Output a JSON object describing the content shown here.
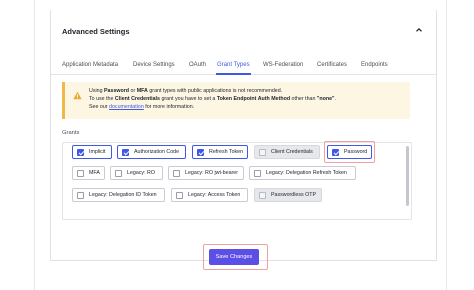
{
  "section": {
    "title": "Advanced Settings"
  },
  "tabs": [
    {
      "label": "Application Metadata",
      "active": false
    },
    {
      "label": "Device Settings",
      "active": false
    },
    {
      "label": "OAuth",
      "active": false
    },
    {
      "label": "Grant Types",
      "active": true
    },
    {
      "label": "WS-Federation",
      "active": false
    },
    {
      "label": "Certificates",
      "active": false
    },
    {
      "label": "Endpoints",
      "active": false
    }
  ],
  "warning": {
    "line1_a": "Using ",
    "line1_b": "Password",
    "line1_c": " or ",
    "line1_d": "MFA",
    "line1_e": " grant types with public applications is not recommended.",
    "line2_a": "To use the ",
    "line2_b": "Client Credentials",
    "line2_c": " grant you have to set a ",
    "line2_d": "Token Endpoint Auth Method",
    "line2_e": " other than ",
    "line2_f": "\"none\"",
    "line2_g": ".",
    "line3_a": "See our ",
    "line3_link": "documentation",
    "line3_b": " for more information."
  },
  "grants": {
    "label": "Grants",
    "items": [
      {
        "label": "Implicit",
        "checked": true,
        "disabled": false
      },
      {
        "label": "Authorization Code",
        "checked": true,
        "disabled": false
      },
      {
        "label": "Refresh Token",
        "checked": true,
        "disabled": false
      },
      {
        "label": "Client Credentials",
        "checked": false,
        "disabled": true
      },
      {
        "label": "Password",
        "checked": true,
        "disabled": false
      },
      {
        "label": "MFA",
        "checked": false,
        "disabled": false
      },
      {
        "label": "Legacy: RO",
        "checked": false,
        "disabled": false
      },
      {
        "label": "Legacy: RO jwt-bearer",
        "checked": false,
        "disabled": false
      },
      {
        "label": "Legacy: Delegation Refresh Token",
        "checked": false,
        "disabled": false
      },
      {
        "label": "Legacy: Delegation ID Token",
        "checked": false,
        "disabled": false
      },
      {
        "label": "Legacy: Access Token",
        "checked": false,
        "disabled": false
      },
      {
        "label": "Passwordless OTP",
        "checked": false,
        "disabled": true
      }
    ]
  },
  "save_button": {
    "label": "Save Changes"
  },
  "colors": {
    "accent": "#3f59e4",
    "button": "#5b4fe6",
    "warning_bg": "#fdf6e3",
    "warning_border": "#f0b849",
    "highlight": "#f0a0a0"
  }
}
